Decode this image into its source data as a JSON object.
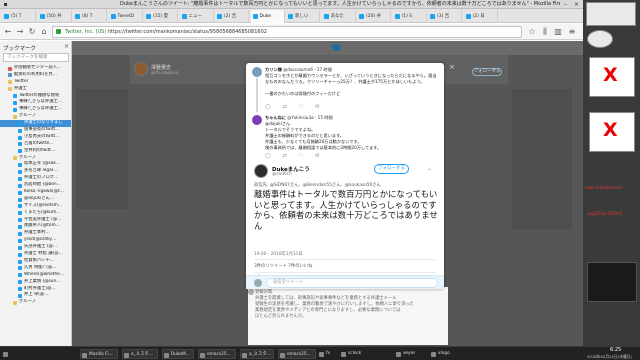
{
  "window": {
    "title": "Dukeまんこうさんのツイート: \"離婚事件はトータルで数百万円とかになってもいいと思ってます。人生かけていらっしゃるのですから、依頼者の未来は数十万どころではありません\" - Mozilla Firefox"
  },
  "tabs": [
    "(5) T",
    "(50) 弁",
    "(8) T",
    "TweetD",
    "(15) 夏",
    "ニュー",
    "(2) 吉",
    "Duke",
    "新しい",
    "あなた",
    "(20) 弁",
    "(1) S",
    "(3) 吉",
    "(2) 日"
  ],
  "url": {
    "site": "Twitter, Inc. (US)",
    "address": "https://twitter.com/mankomaniac/status/958056884685081602"
  },
  "sidebar": {
    "title": "ブックマーク",
    "search_placeholder": "ブックマークを検索",
    "items": [
      {
        "label": "外国籍者センター前入…",
        "depth": 1,
        "color": "#d9534f"
      },
      {
        "label": "能勢町の利用料を見…",
        "depth": 1,
        "color": "#5b8dd9"
      },
      {
        "label": "Twitter",
        "depth": 1,
        "color": "#e8c35a"
      },
      {
        "label": "弁護士",
        "depth": 1,
        "color": "#e8c35a"
      },
      {
        "label": "Twitterの雅樹な規制",
        "depth": 2,
        "color": "#1da1f2"
      },
      {
        "label": "事練?_さらば弁護士…",
        "depth": 2,
        "color": "#1da1f2"
      },
      {
        "label": "事練?_さらば弁護士…",
        "depth": 2,
        "color": "#1da1f2"
      },
      {
        "label": "グループ",
        "depth": 2,
        "color": "#e8c35a"
      },
      {
        "label": "弁護士のなりすまし",
        "depth": 3,
        "color": "#1da1f2",
        "selected": true
      },
      {
        "label": "国事部長のtwitt…",
        "depth": 3,
        "color": "#1da1f2"
      },
      {
        "label": "小島秀夫のtwitt…",
        "depth": 3,
        "color": "#1da1f2"
      },
      {
        "label": "吉富のtwitte…",
        "depth": 3,
        "color": "#1da1f2"
      },
      {
        "label": "金井利のtwitt…",
        "depth": 3,
        "color": "#1da1f2"
      },
      {
        "label": "グループ",
        "depth": 2,
        "color": "#e8c35a"
      },
      {
        "label": "坂本正幸 (@sak…",
        "depth": 3,
        "color": "#1da1f2"
      },
      {
        "label": "多名吉琢 legal…",
        "depth": 3,
        "color": "#1da1f2"
      },
      {
        "label": "弁護士のブログ…",
        "depth": 3,
        "color": "#1da1f2"
      },
      {
        "label": "別居時給 (@ben…",
        "depth": 3,
        "color": "#1da1f2"
      },
      {
        "label": "Keiko Tigawa(@t…",
        "depth": 3,
        "color": "#1da1f2"
      },
      {
        "label": "@dojukiさん…",
        "depth": 3,
        "color": "#1da1f2"
      },
      {
        "label": "サイズ(@rootsm…",
        "depth": 3,
        "color": "#1da1f2"
      },
      {
        "label": "くまたろ(@kum…",
        "depth": 3,
        "color": "#1da1f2"
      },
      {
        "label": "宇佐美弁護士 (@…",
        "depth": 3,
        "color": "#1da1f2"
      },
      {
        "label": "後藤県人(@tom…",
        "depth": 3,
        "color": "#1da1f2"
      },
      {
        "label": "弁護士本村…",
        "depth": 3,
        "color": "#1da1f2"
      },
      {
        "label": "yslid(@ssltky…",
        "depth": 3,
        "color": "#1da1f2"
      },
      {
        "label": "矢部弁護士 (@…",
        "depth": 3,
        "color": "#1da1f2"
      },
      {
        "label": "弁護士 村松 謙(@…",
        "depth": 3,
        "color": "#1da1f2"
      },
      {
        "label": "佐賀製バシチ…",
        "depth": 3,
        "color": "#1da1f2"
      },
      {
        "label": "久男 明能? (@…",
        "depth": 3,
        "color": "#1da1f2"
      },
      {
        "label": "Where(@whothe…",
        "depth": 3,
        "color": "#1da1f2"
      },
      {
        "label": "弁上業慎 (@sun…",
        "depth": 3,
        "color": "#1da1f2"
      },
      {
        "label": "町村弁護士(@…",
        "depth": 3,
        "color": "#1da1f2"
      },
      {
        "label": "井上 卓(@…",
        "depth": 3,
        "color": "#1da1f2"
      },
      {
        "label": "グループ",
        "depth": 2,
        "color": "#e8c35a"
      }
    ]
  },
  "profile": {
    "name": "澤雅憲史",
    "handle": "@fb.sawano",
    "follow_label": "フォローする"
  },
  "modal": {
    "close": "×",
    "replies": [
      {
        "name": "カリン様",
        "meta": "@doccolumn6 · 17 時間",
        "body": "相互コンモホとか離婚カウンセラーとか、いざっていうときになったらだになるやら。適当なもののなんだうろ。クソリーチャーっ25万？、弁護士が175万とかほしいもよう。\n\n一番のかたいのは保険付のフィーだけど",
        "avatar_color": "#7a9bbf"
      },
      {
        "name": "ちゃんねに",
        "meta": "@Yukinsiu3a · 15 時間",
        "body": "@dojukiさん\nトータルでそうですよね。\n弁護士の報酬料ができるのだと思います。\n弁護士も、少なくても月報酬20万は動かないです。\n僕の事務所では、離婚相談では基本的に2時間20万してます。",
        "avatar_color": "#7b3fb0"
      }
    ]
  },
  "tweet": {
    "name": "Dukeまんこう",
    "handle": "@sad6cn",
    "follow_label": "フォローする",
    "reply_to": "返信先: @SiDN67さん、@Benndari55さん、@koukaso56さん",
    "text": "離婚事件はトータルで数百万円とかになってもいいと思ってます。人生かけていらっしゃるのですから、依頼者の未来は数十万どころではありません",
    "date": "19:00 - 2018年1月31日",
    "stats": "3件のリツイート  7件のいいね",
    "actions": [
      "◯",
      "⇄",
      "♡",
      "✉"
    ],
    "reply_placeholder": "返信をツイート"
  },
  "lower_tweet": {
    "lines": [
      "受験対策",
      "弁護士を開業しては、刑事訴訟や家事事件などを業務とする弁護士メール",
      "受験生の実感を考慮し、業務の難易で速やかに行いしますし、依頼人に寄り添った",
      "業務規定を業界やメディアとの専門とになりますし、必要な業務については",
      "ほとんど見られませんか。"
    ]
  },
  "taskbar": {
    "items": [
      "",
      "Mozilla Fi...",
      "a_ミスタ...",
      "DukeM...",
      "emacs25...",
      "a_ミスタ...",
      "emacs25...",
      "fx",
      "sclock",
      "xeyes",
      "xlogo"
    ],
    "time": "6:25",
    "date": "2018年02月22日(木曜日)"
  },
  "desktop": {
    "labels": [
      "nsbl-example.com",
      "org2018y-2018-0"
    ]
  }
}
